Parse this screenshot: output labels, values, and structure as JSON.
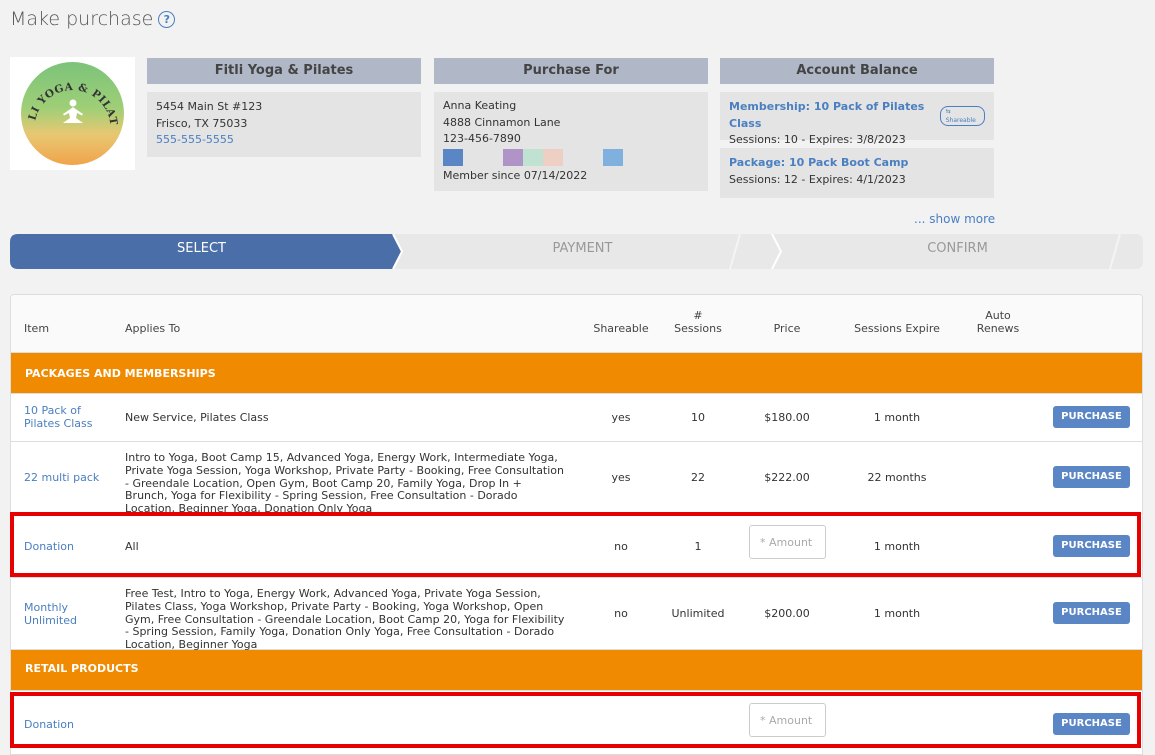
{
  "page": {
    "title": "Make purchase"
  },
  "business": {
    "name": "Fitli Yoga & Pilates",
    "logo_text": "FITLI YOGA & PILATES",
    "address1": "5454 Main St #123",
    "address2": "Frisco, TX 75033",
    "phone": "555-555-5555"
  },
  "customer": {
    "header": "Purchase For",
    "name": "Anna Keating",
    "address": "4888 Cinnamon Lane",
    "phone": "123-456-7890",
    "member_since": "Member since 07/14/2022",
    "swatch_colors": [
      "#5a86c5",
      "#e4e4e4",
      "#e4e4e4",
      "#b094c8",
      "#bfe2d3",
      "#edd0c3",
      "#e4e4e4",
      "#e4e4e4",
      "#7fb0de"
    ]
  },
  "balance": {
    "header": "Account Balance",
    "items": [
      {
        "title": "Membership: 10 Pack of Pilates Class",
        "badge": "Shareable",
        "detail": "Sessions: 10 -  Expires: 3/8/2023"
      },
      {
        "title": "Package: 10 Pack Boot Camp",
        "detail": "Sessions: 12 -  Expires: 4/1/2023"
      }
    ],
    "show_more": "... show more"
  },
  "steps": [
    "SELECT",
    "PAYMENT",
    "CONFIRM"
  ],
  "table": {
    "headers": {
      "item": "Item",
      "applies_to": "Applies To",
      "shareable": "Shareable",
      "sessions_line1": "#",
      "sessions_line2": "Sessions",
      "price": "Price",
      "sessions_expire": "Sessions Expire",
      "auto_renews_line1": "Auto",
      "auto_renews_line2": "Renews"
    },
    "sections": {
      "packages": "PACKAGES AND MEMBERSHIPS",
      "retail": "RETAIL PRODUCTS"
    },
    "rows": [
      {
        "item_line1": "10 Pack of",
        "item_line2": "Pilates Class",
        "applies_to": "New Service, Pilates Class",
        "shareable": "yes",
        "sessions": "10",
        "price": "$180.00",
        "expire": "1 month",
        "button": "PURCHASE"
      },
      {
        "item_line1": "22 multi pack",
        "applies_to": "Intro to Yoga, Boot Camp 15, Advanced Yoga, Energy Work, Intermediate Yoga, Private Yoga Session, Yoga Workshop, Private Party - Booking, Free Consultation - Greendale Location, Open Gym, Boot Camp 20, Family Yoga, Drop In + Brunch, Yoga for Flexibility - Spring Session, Free Consultation - Dorado Location, Beginner Yoga, Donation Only Yoga",
        "shareable": "yes",
        "sessions": "22",
        "price": "$222.00",
        "expire": "22 months",
        "button": "PURCHASE"
      },
      {
        "item_line1": "Donation",
        "applies_to": "All",
        "shareable": "no",
        "sessions": "1",
        "price_placeholder": "* Amount",
        "expire": "1 month",
        "button": "PURCHASE"
      },
      {
        "item_line1": "Monthly",
        "item_line2": "Unlimited",
        "applies_to": "Free Test, Intro to Yoga, Energy Work, Advanced Yoga, Private Yoga Session, Pilates Class, Yoga Workshop, Private Party - Booking, Yoga Workshop, Open Gym, Free Consultation - Greendale Location, Boot Camp 20, Yoga for Flexibility - Spring Session, Family Yoga, Donation Only Yoga, Free Consultation - Dorado Location, Beginner Yoga",
        "shareable": "no",
        "sessions": "Unlimited",
        "price": "$200.00",
        "expire": "1 month",
        "button": "PURCHASE"
      }
    ],
    "retail_rows": [
      {
        "item_line1": "Donation",
        "price_placeholder": "* Amount",
        "button": "PURCHASE"
      }
    ]
  }
}
